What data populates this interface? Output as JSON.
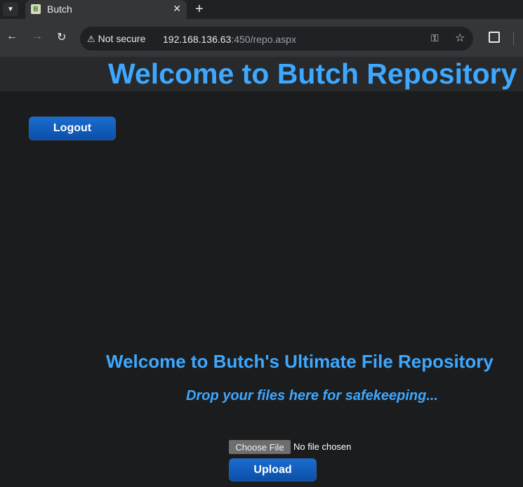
{
  "browser": {
    "tab_title": "Butch",
    "tab_favicon_letter": "B",
    "close_glyph": "✕",
    "new_tab_glyph": "+",
    "security_label": "Not secure",
    "url_host": "192.168.136.63",
    "url_rest": ":450/repo.aspx"
  },
  "page": {
    "header_title": "Welcome to Butch Repository",
    "logout_label": "Logout",
    "welcome_heading": "Welcome to Butch's Ultimate File Repository",
    "tagline": "Drop your files here for safekeeping...",
    "choose_file_label": "Choose File",
    "no_file_label": "No file chosen",
    "upload_label": "Upload"
  },
  "colors": {
    "accent": "#3ea8ff",
    "button_blue": "#0b4fa8",
    "background": "#1b1c1e"
  }
}
